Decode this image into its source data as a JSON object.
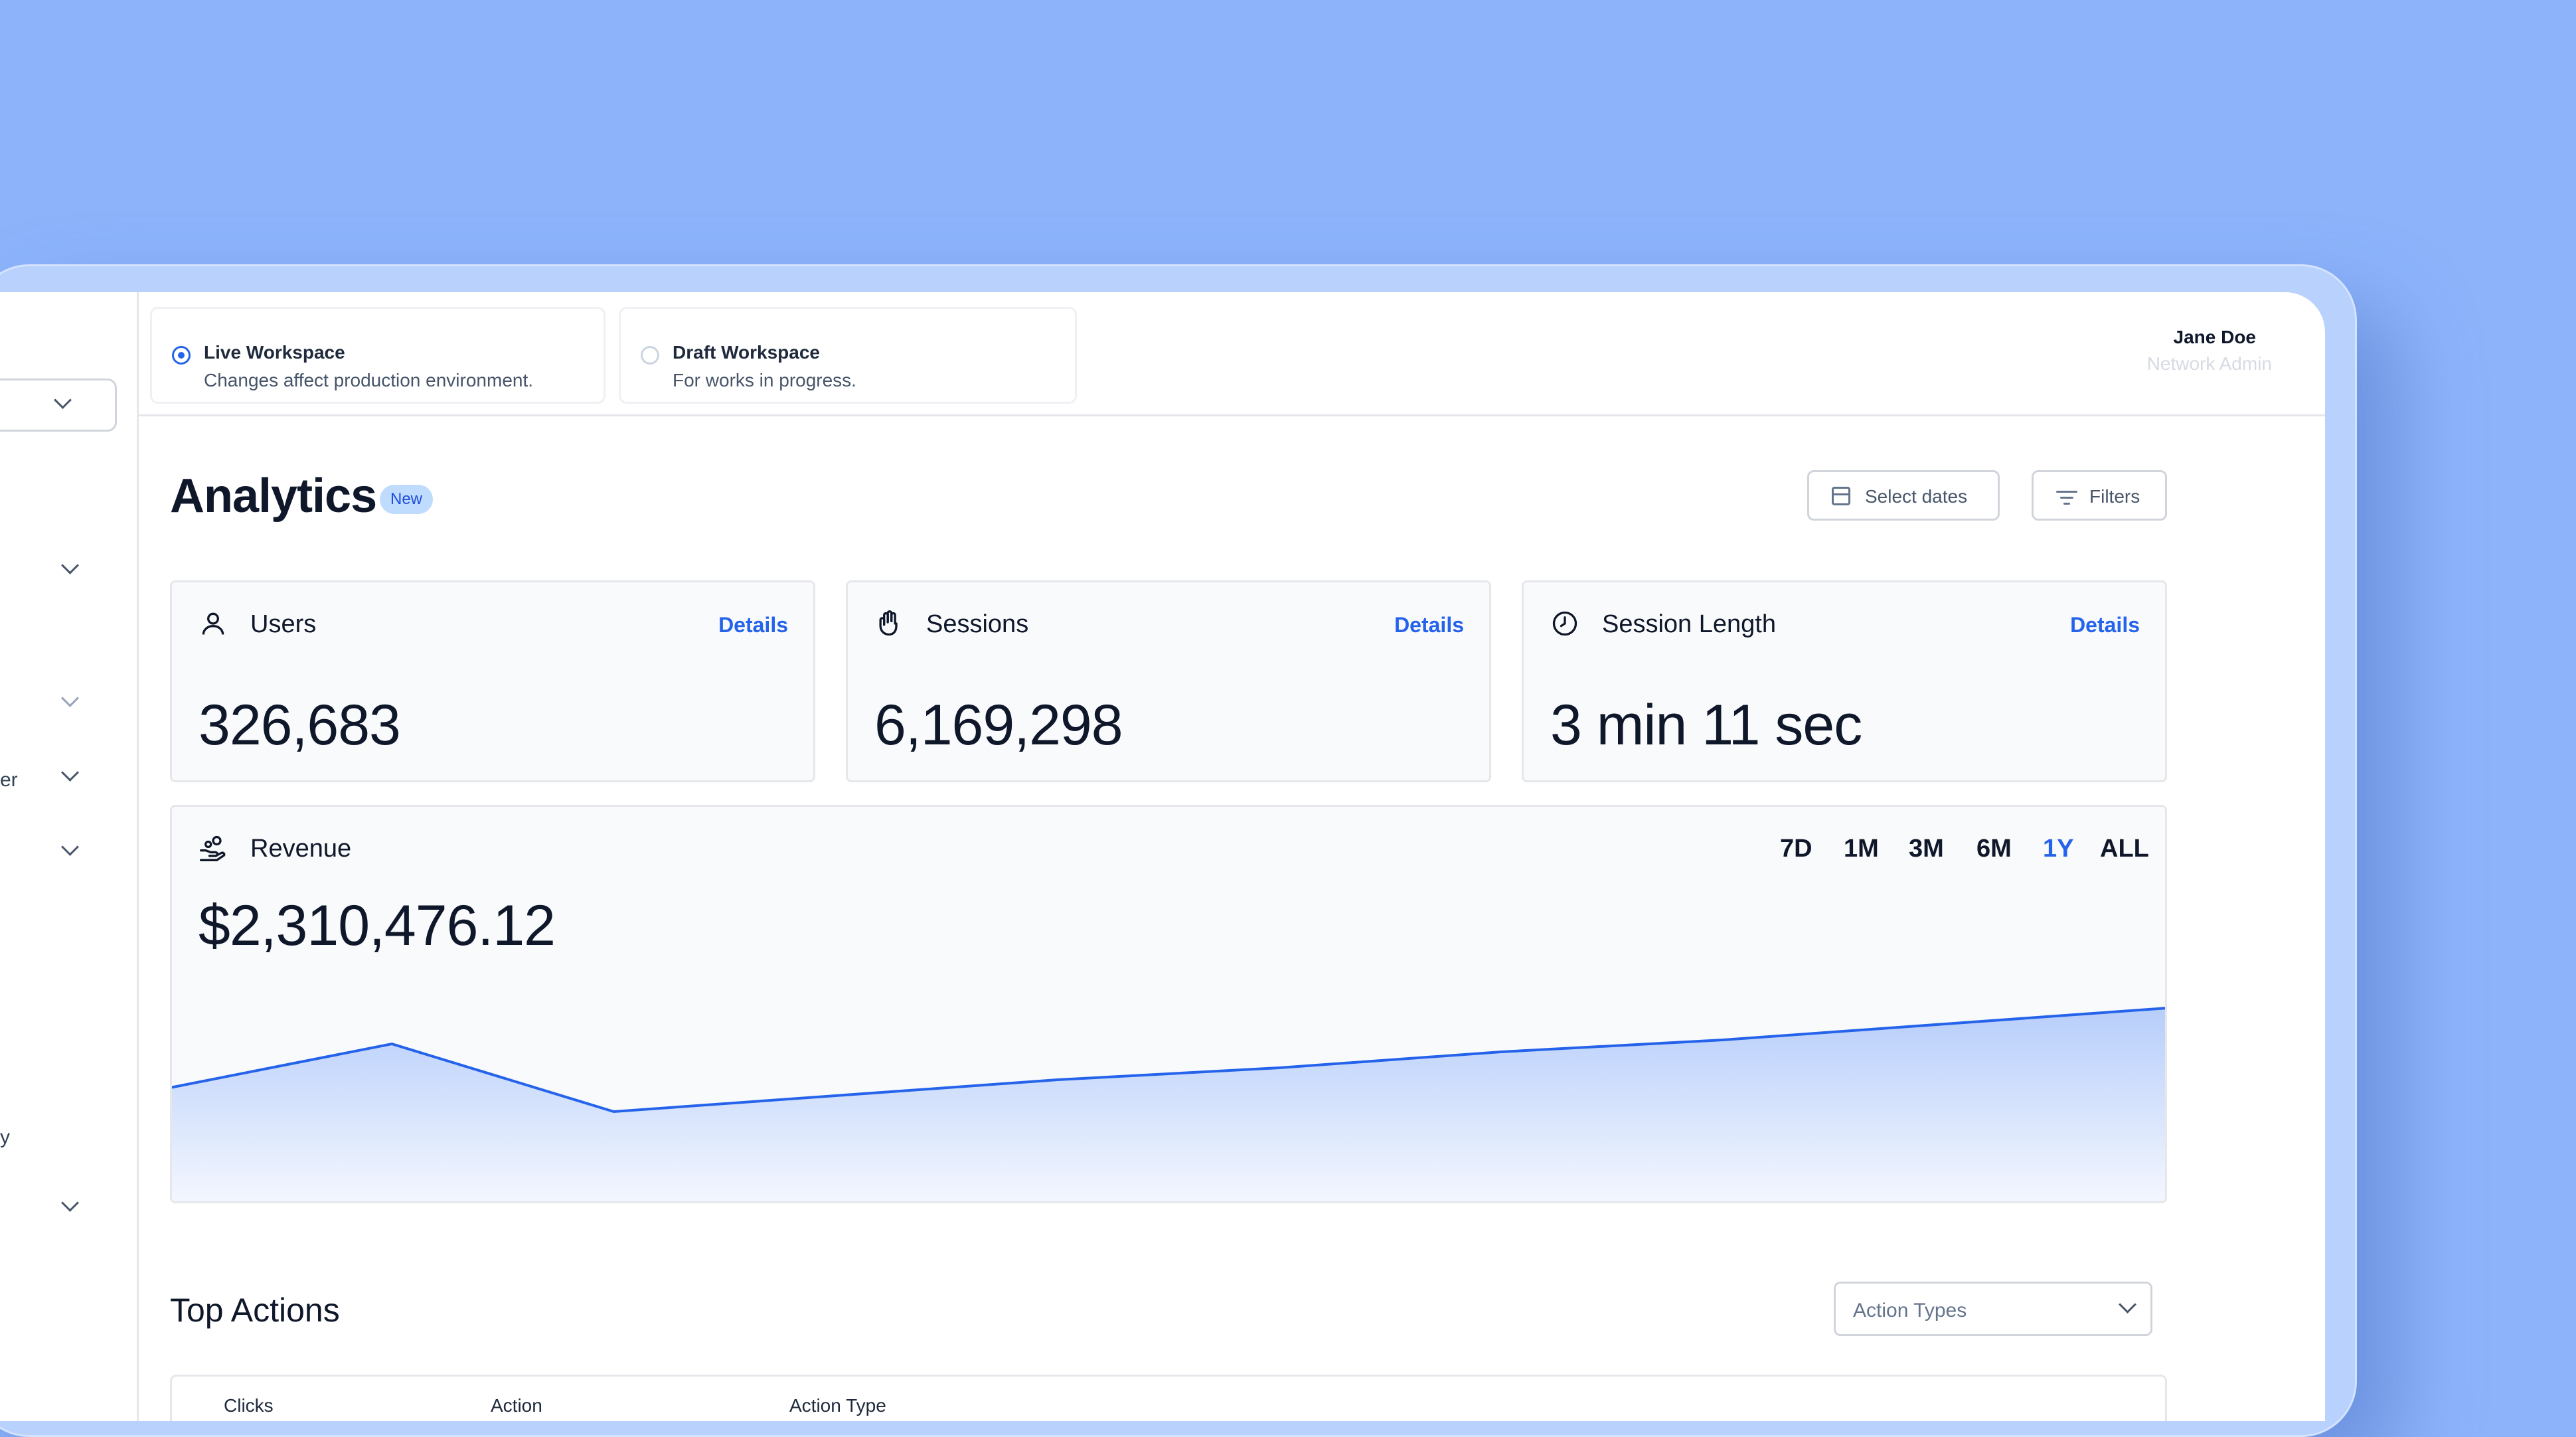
{
  "sidebar": {
    "partial_items": [
      "er",
      "y"
    ]
  },
  "header": {
    "workspaces": [
      {
        "title": "Live Workspace",
        "description": "Changes affect production environment.",
        "selected": true
      },
      {
        "title": "Draft Workspace",
        "description": "For works in progress.",
        "selected": false
      }
    ],
    "user": {
      "name": "Jane Doe",
      "role": "Network Admin"
    }
  },
  "main": {
    "title": "Analytics",
    "badge": "New",
    "select_dates_label": "Select dates",
    "filters_label": "Filters",
    "stats": [
      {
        "icon": "user-icon",
        "label": "Users",
        "link": "Details",
        "value": "326,683"
      },
      {
        "icon": "hand-icon",
        "label": "Sessions",
        "link": "Details",
        "value": "6,169,298"
      },
      {
        "icon": "clock-icon",
        "label": "Session Length",
        "link": "Details",
        "value": "3 min 11 sec"
      }
    ],
    "revenue": {
      "icon": "hand-coins-icon",
      "label": "Revenue",
      "value": "$2,310,476.12",
      "ranges": [
        "7D",
        "1M",
        "3M",
        "6M",
        "1Y",
        "ALL"
      ],
      "active_range": "1Y"
    },
    "top_actions": {
      "title": "Top Actions",
      "filter_label": "Action Types",
      "columns": [
        "Clicks",
        "Action",
        "Action Type"
      ]
    }
  },
  "colors": {
    "accent": "#2563eb",
    "background": "#8db4fb",
    "chart_fill": "#bfd3fb"
  },
  "chart_data": {
    "type": "area",
    "x": [
      0,
      1,
      2,
      3,
      4,
      5,
      6,
      7,
      8,
      9
    ],
    "values": [
      0.29,
      0.4,
      0.23,
      0.27,
      0.31,
      0.34,
      0.38,
      0.41,
      0.45,
      0.49
    ],
    "ylim": [
      0,
      1
    ],
    "grid": false,
    "legend": "none",
    "title": "",
    "xlabel": "",
    "ylabel": ""
  }
}
